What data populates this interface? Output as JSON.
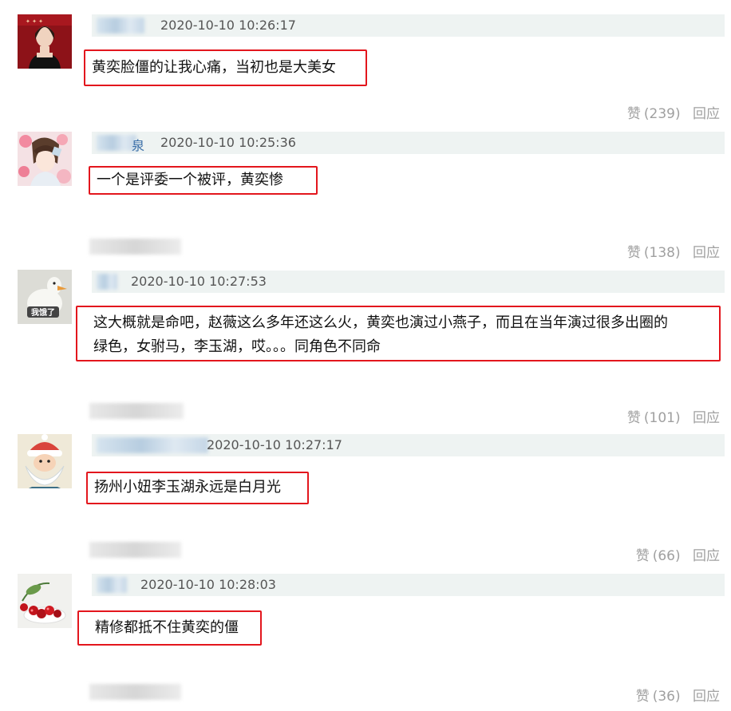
{
  "comments": [
    {
      "timestamp": "2020-10-10 10:26:17",
      "username_tail": "",
      "text_lines": [
        "黄奕脸僵的让我心痛，当初也是大美女"
      ],
      "like_label": "赞",
      "like_count": "(239)",
      "reply_label": "回应",
      "avatar_icon": "portrait-red-backdrop"
    },
    {
      "timestamp": "2020-10-10 10:25:36",
      "username_tail": "泉",
      "text_lines": [
        "一个是评委一个被评，黄奕惨"
      ],
      "like_label": "赞",
      "like_count": "(138)",
      "reply_label": "回应",
      "avatar_icon": "anime-flowers"
    },
    {
      "timestamp": "2020-10-10 10:27:53",
      "username_tail": "",
      "text_lines": [
        "这大概就是命吧，赵薇这么多年还这么火，黄奕也演过小燕子，而且在当年演过很多出圈的",
        "绿色，女驸马，李玉湖，哎。。。同角色不同命"
      ],
      "like_label": "赞",
      "like_count": "(101)",
      "reply_label": "回应",
      "avatar_icon": "goose-sticker",
      "avatar_text": "我饿了"
    },
    {
      "timestamp": "2020-10-10 10:27:17",
      "username_tail": "",
      "text_lines": [
        "扬州小妞李玉湖永远是白月光"
      ],
      "like_label": "赞",
      "like_count": "(66)",
      "reply_label": "回应",
      "avatar_icon": "santa-cartoon"
    },
    {
      "timestamp": "2020-10-10 10:28:03",
      "username_tail": "",
      "text_lines": [
        "精修都抵不住黄奕的僵"
      ],
      "like_label": "赞",
      "like_count": "(36)",
      "reply_label": "回应",
      "avatar_icon": "cherries-photo"
    }
  ],
  "colors": {
    "highlight_border": "#e3161d",
    "meta_bar_bg": "#eef3f2",
    "action_text": "#a0a0a0"
  }
}
